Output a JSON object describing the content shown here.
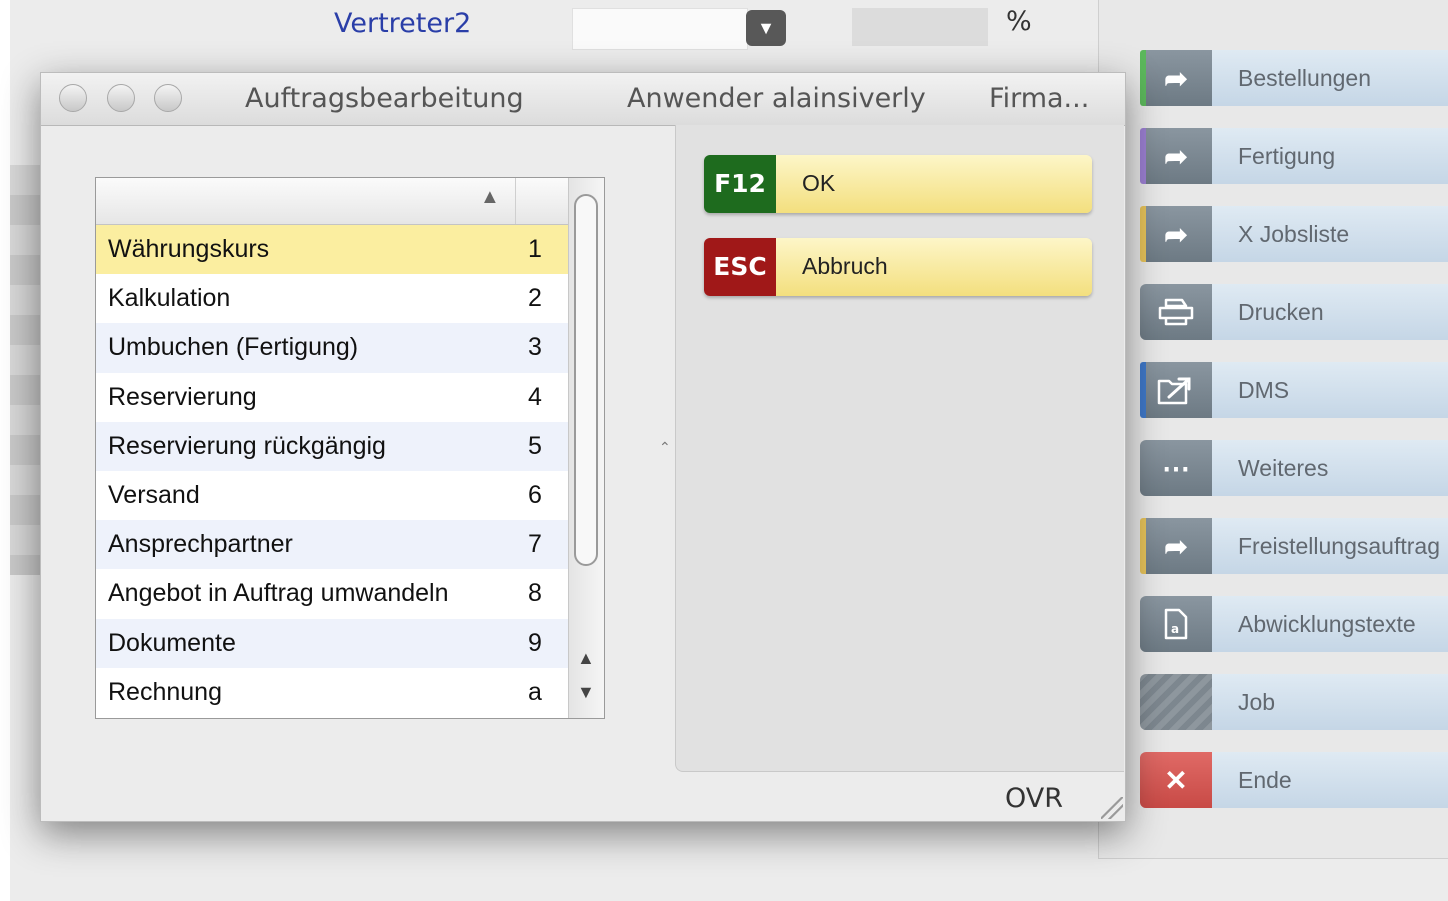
{
  "background": {
    "vertreter_label": "Vertreter2",
    "percent_sign": "%"
  },
  "dialog": {
    "title": "Auftragsbearbeitung",
    "user_label": "Anwender alainsiverly",
    "company_label": "Firma...",
    "status": "OVR",
    "list": {
      "sort_indicator": "▲",
      "rows": [
        {
          "label": "Währungskurs",
          "key": "1"
        },
        {
          "label": "Kalkulation",
          "key": "2"
        },
        {
          "label": "Umbuchen (Fertigung)",
          "key": "3"
        },
        {
          "label": "Reservierung",
          "key": "4"
        },
        {
          "label": "Reservierung rückgängig",
          "key": "5"
        },
        {
          "label": "Versand",
          "key": "6"
        },
        {
          "label": "Ansprechpartner",
          "key": "7"
        },
        {
          "label": "Angebot in Auftrag umwandeln",
          "key": "8"
        },
        {
          "label": "Dokumente",
          "key": "9"
        },
        {
          "label": "Rechnung",
          "key": "a"
        }
      ]
    },
    "actions": {
      "ok": {
        "key": "F12",
        "label": "OK",
        "key_color": "#1e6b1e"
      },
      "cancel": {
        "key": "ESC",
        "label": "Abbruch",
        "key_color": "#a01818"
      }
    }
  },
  "sidebar": {
    "items": [
      {
        "label": "Bestellungen",
        "icon": "arrow-right-icon",
        "stripe": "#5cb85c"
      },
      {
        "label": "Fertigung",
        "icon": "arrow-right-icon",
        "stripe": "#9b7fd1"
      },
      {
        "label": "X Jobsliste",
        "icon": "arrow-right-icon",
        "stripe": "#e6c25a"
      },
      {
        "label": "Drucken",
        "icon": "printer-icon",
        "stripe": ""
      },
      {
        "label": "DMS",
        "icon": "folder-export-icon",
        "stripe": "#3f78c8"
      },
      {
        "label": "Weiteres",
        "icon": "more-dots-icon",
        "stripe": ""
      },
      {
        "label": "Freistellungsauftrag",
        "icon": "arrow-right-icon",
        "stripe": "#e6c25a"
      },
      {
        "label": "Abwicklungstexte",
        "icon": "document-icon",
        "stripe": ""
      },
      {
        "label": "Job",
        "icon": "job-hatch-icon",
        "stripe": ""
      },
      {
        "label": "Ende",
        "icon": "close-icon",
        "stripe": "#d9534f"
      }
    ]
  }
}
